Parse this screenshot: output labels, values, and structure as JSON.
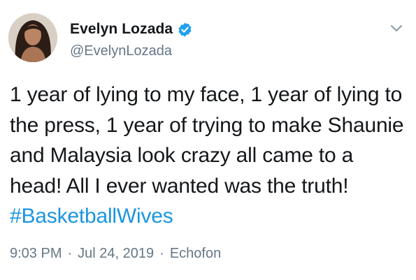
{
  "tweet": {
    "author": {
      "display_name": "Evelyn Lozada",
      "handle": "@EvelynLozada",
      "verified": true,
      "avatar_icon": "profile-photo"
    },
    "text_main": "1 year of lying to my face, 1 year of lying to the press, 1 year of trying to make Shaunie and Malaysia look crazy all came to a head! All I ever wanted was the truth! ",
    "hashtag": "#BasketballWives",
    "time": "9:03 PM",
    "separator": "·",
    "date": "Jul 24, 2019",
    "source": "Echofon",
    "menu_icon": "chevron-down-icon"
  },
  "colors": {
    "text": "#14171a",
    "secondary": "#657786",
    "link": "#1b95e0",
    "verified_badge": "#1da1f2"
  }
}
